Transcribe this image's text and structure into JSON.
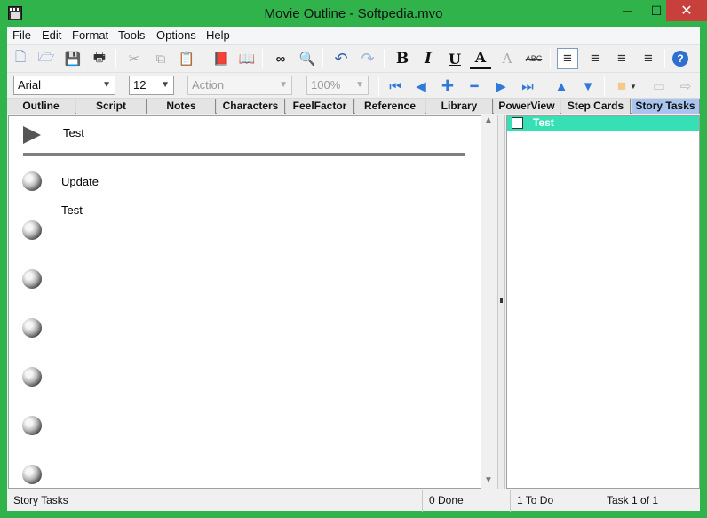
{
  "window": {
    "title": "Movie Outline - Softpedia.mvo",
    "minimize": "─",
    "maximize": "☐",
    "close": "✕"
  },
  "menu": [
    "File",
    "Edit",
    "Format",
    "Tools",
    "Options",
    "Help"
  ],
  "toolbar1": {
    "new": "🗋",
    "open": "🗁",
    "save": "💾",
    "print": "🖶",
    "cut": "✂",
    "copy": "⧉",
    "paste": "📋",
    "book1": "📕",
    "book2": "📖",
    "find": "🔍",
    "binoculars": "∞",
    "undo": "↶",
    "redo": "↷",
    "bold": "B",
    "italic": "I",
    "underline": "U",
    "font_color": "A",
    "clear": "A",
    "spell": "ABC",
    "align_left": "≡",
    "align_center": "≡",
    "align_right": "≡",
    "justify": "≡",
    "help": "?"
  },
  "toolbar2": {
    "font": "Arial",
    "size": "12",
    "style": "Action",
    "zoom": "100%",
    "first": "⏮",
    "prev": "◀",
    "add": "✚",
    "remove": "━",
    "next": "▶",
    "last": "⏭",
    "up": "▲",
    "down": "▼",
    "color": "■",
    "card": "▭",
    "export": "⇨"
  },
  "tabs": [
    "Outline",
    "Script",
    "Notes",
    "Characters",
    "FeelFactor",
    "Reference",
    "Library",
    "PowerView",
    "Step Cards",
    "Story Tasks"
  ],
  "active_tab": "Story Tasks",
  "left_pane": {
    "scene": "Test",
    "items": [
      "Update",
      "Test"
    ]
  },
  "right_pane": {
    "tasks": [
      {
        "label": "Test",
        "done": false
      }
    ]
  },
  "status": {
    "panel": "Story Tasks",
    "done": "0 Done",
    "todo": "1 To Do",
    "task": "Task 1 of 1"
  },
  "colors": {
    "titlebar": "#2fb34a",
    "active_tab": "#a8c4ef",
    "task_highlight": "#37e0b4",
    "close": "#c7403b"
  }
}
